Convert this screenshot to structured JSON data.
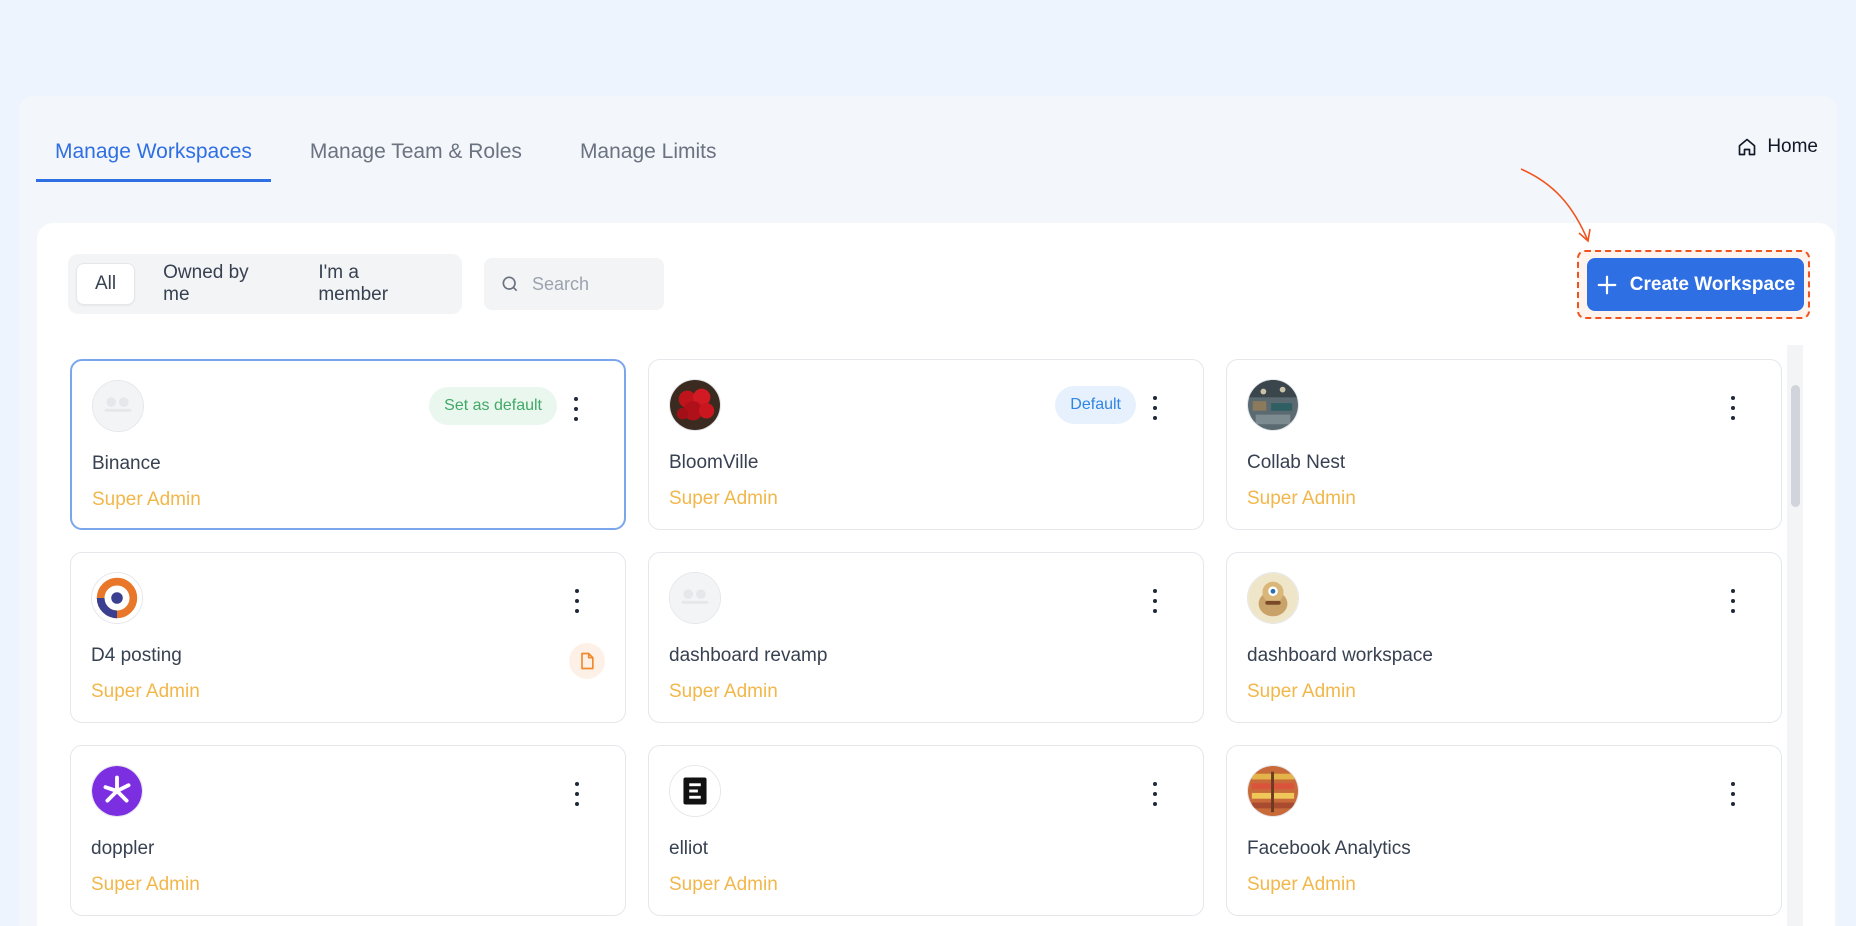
{
  "tabs": [
    {
      "label": "Manage Workspaces",
      "active": true
    },
    {
      "label": "Manage Team & Roles",
      "active": false
    },
    {
      "label": "Manage Limits",
      "active": false
    }
  ],
  "home": {
    "label": "Home",
    "icon": "home-icon"
  },
  "filters": [
    {
      "label": "All",
      "active": true
    },
    {
      "label": "Owned by me",
      "active": false
    },
    {
      "label": "I'm a member",
      "active": false
    }
  ],
  "search": {
    "placeholder": "Search",
    "value": ""
  },
  "create_button": {
    "label": "Create Workspace",
    "icon": "plus-icon"
  },
  "colors": {
    "accent": "#2f6fe4",
    "role": "#f2b74a",
    "highlight": "#f0531e",
    "badge_green": "#41a867",
    "badge_blue": "#2f85e4"
  },
  "workspaces": [
    {
      "name": "Binance",
      "role": "Super Admin",
      "badge": "Set as default",
      "logo": "placeholder-logo"
    },
    {
      "name": "BloomVille",
      "role": "Super Admin",
      "badge": "Default",
      "logo": "roses-logo"
    },
    {
      "name": "Collab Nest",
      "role": "Super Admin",
      "logo": "office-logo"
    },
    {
      "name": "D4 posting",
      "role": "Super Admin",
      "logo": "d4-logo",
      "extra_icon": "document-icon"
    },
    {
      "name": "dashboard revamp",
      "role": "Super Admin",
      "logo": "placeholder-logo"
    },
    {
      "name": "dashboard workspace",
      "role": "Super Admin",
      "logo": "character-logo"
    },
    {
      "name": "doppler",
      "role": "Super Admin",
      "logo": "doppler-logo"
    },
    {
      "name": "elliot",
      "role": "Super Admin",
      "logo": "elliot-logo"
    },
    {
      "name": "Facebook Analytics",
      "role": "Super Admin",
      "logo": "shelves-logo"
    }
  ]
}
